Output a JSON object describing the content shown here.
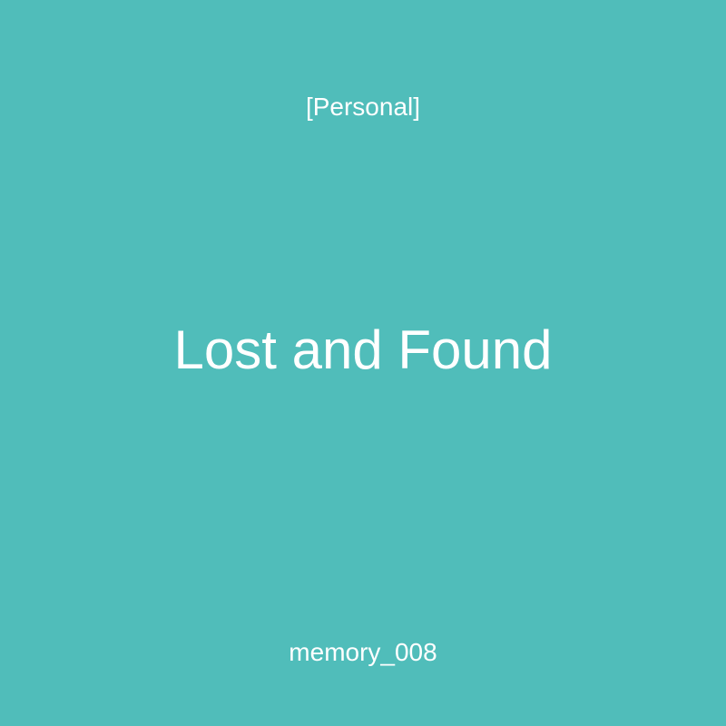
{
  "card": {
    "category": "[Personal]",
    "title": "Lost and Found",
    "label": "memory_008",
    "background_color": "#50bdba",
    "text_color": "#ffffff"
  }
}
